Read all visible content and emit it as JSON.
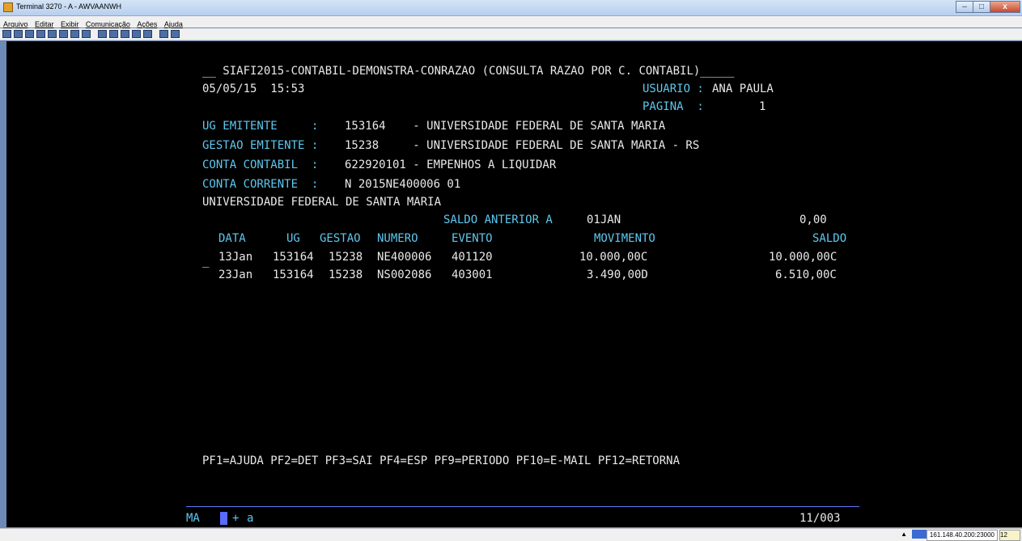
{
  "window": {
    "title": "Terminal 3270 - A - AWVAANWH",
    "minimize": "–",
    "maximize": "□",
    "close": "x"
  },
  "menu": [
    "Arquivo",
    "Editar",
    "Exibir",
    "Comunicação",
    "Ações",
    "Ajuda"
  ],
  "toolbar_icons": [
    "copy-icon",
    "paste-icon",
    "print-icon",
    "cut-icon",
    "lock-icon",
    "send-icon",
    "map-icon",
    "grid-icon",
    "upload-icon",
    "download-icon",
    "chart-icon",
    "chart-icon",
    "message-icon",
    "disk-icon",
    "help-icon"
  ],
  "screen": {
    "header": "__ SIAFI2015-CONTABIL-DEMONSTRA-CONRAZAO (CONSULTA RAZAO POR C. CONTABIL)_____",
    "datetime": "05/05/15  15:53",
    "usuario_label": "USUARIO :",
    "usuario_value": "ANA PAULA",
    "pagina_label": "PAGINA  :",
    "pagina_value": "1",
    "ug_label": "UG EMITENTE     :",
    "ug_value": "153164    - UNIVERSIDADE FEDERAL DE SANTA MARIA",
    "gestao_label": "GESTAO EMITENTE :",
    "gestao_value": "15238     - UNIVERSIDADE FEDERAL DE SANTA MARIA - RS",
    "conta_label": "CONTA CONTABIL  :",
    "conta_value": "622920101 - EMPENHOS A LIQUIDAR",
    "corrente_label": "CONTA CORRENTE  :",
    "corrente_value": "N 2015NE400006 01",
    "org_name": "UNIVERSIDADE FEDERAL DE SANTA MARIA",
    "saldo_anterior_label": "SALDO ANTERIOR A",
    "saldo_anterior_date": "01JAN",
    "saldo_anterior_value": "0,00",
    "columns": {
      "data": "DATA",
      "ug": "UG",
      "gestao": "GESTAO",
      "numero": "NUMERO",
      "evento": "EVENTO",
      "movimento": "MOVIMENTO",
      "saldo": "SALDO"
    },
    "rows": [
      {
        "marker": "_",
        "data": "13Jan",
        "ug": "153164",
        "gestao": "15238",
        "numero": "NE400006",
        "evento": "401120",
        "movimento": "10.000,00C",
        "saldo": "10.000,00C"
      },
      {
        "marker": "",
        "data": "23Jan",
        "ug": "153164",
        "gestao": "15238",
        "numero": "NS002086",
        "evento": "403001",
        "movimento": "3.490,00D",
        "saldo": "6.510,00C"
      }
    ],
    "pf_keys": "PF1=AJUDA PF2=DET PF3=SAI PF4=ESP PF9=PERIODO PF10=E-MAIL PF12=RETORNA",
    "oia": {
      "ma": "MA",
      "plus": "+",
      "a": "a",
      "position": "11/003"
    }
  },
  "status_bar": {
    "host": "161.148.40.200:23000",
    "page": "12"
  }
}
